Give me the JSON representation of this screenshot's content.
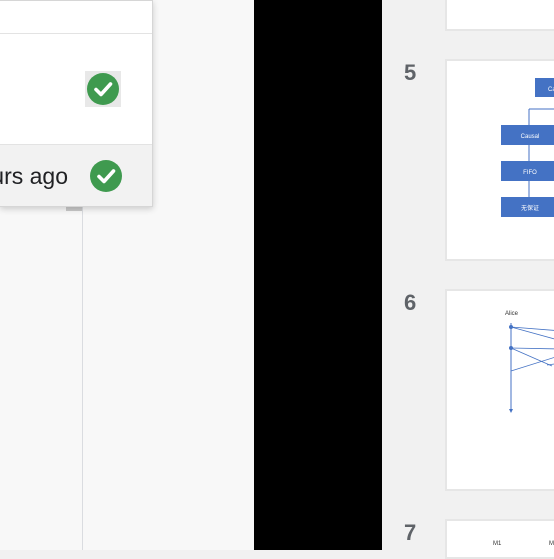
{
  "history_popup": {
    "rows": [
      {
        "label": "",
        "status_icon": "check-circle-icon"
      },
      {
        "label": "",
        "status_icon": "check-circle-icon"
      },
      {
        "label": "urs ago",
        "status_icon": "check-circle-icon"
      }
    ]
  },
  "filmstrip": {
    "slides": [
      {
        "number": "5",
        "texts": [
          "Ca",
          "Causal",
          "FIFO",
          "无保证"
        ]
      },
      {
        "number": "6",
        "texts": [
          "Alice"
        ]
      },
      {
        "number": "7",
        "texts": [
          "M1",
          "M"
        ]
      }
    ]
  },
  "colors": {
    "check_green": "#3f9a4f",
    "diagram_blue": "#4472c4",
    "slide_number": "#5f6368"
  }
}
